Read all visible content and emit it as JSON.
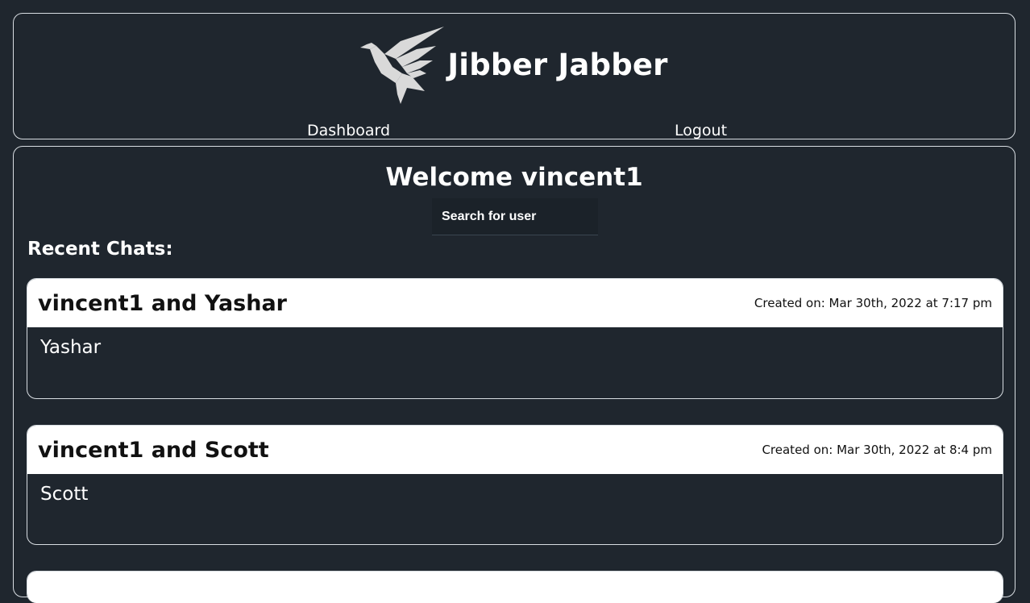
{
  "app": {
    "title": "Jibber Jabber",
    "logo_icon": "bird-logo-icon"
  },
  "nav": {
    "dashboard": "Dashboard",
    "logout": "Logout"
  },
  "main": {
    "welcome": "Welcome vincent1",
    "search_placeholder": "Search for user",
    "recent_heading": "Recent Chats:"
  },
  "chats": [
    {
      "title": "vincent1 and Yashar",
      "created": "Created on: Mar 30th, 2022 at 7:17 pm",
      "participant": "Yashar"
    },
    {
      "title": "vincent1 and Scott",
      "created": "Created on: Mar 30th, 2022 at 8:4 pm",
      "participant": "Scott"
    }
  ],
  "colors": {
    "background": "#1f262e",
    "card_header": "#ffffff",
    "border": "#d8dde2"
  }
}
